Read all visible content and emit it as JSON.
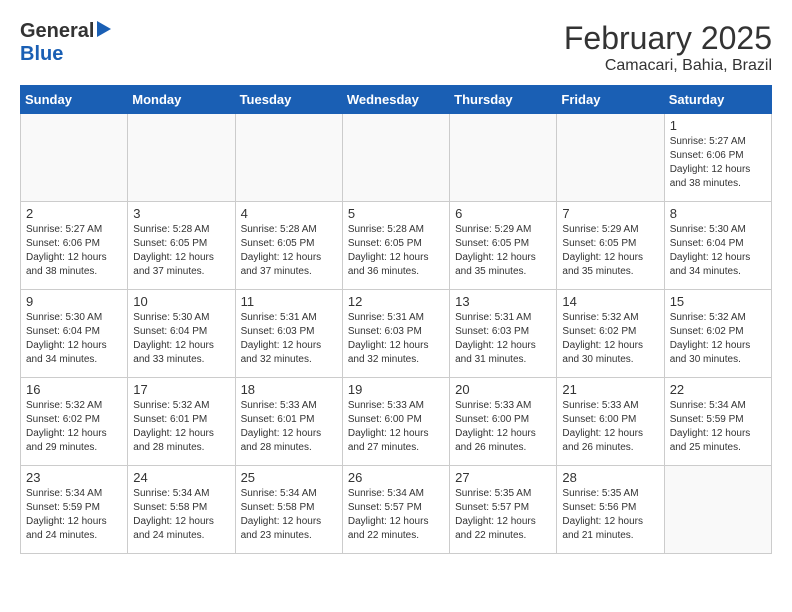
{
  "header": {
    "logo_general": "General",
    "logo_blue": "Blue",
    "title": "February 2025",
    "subtitle": "Camacari, Bahia, Brazil"
  },
  "days_of_week": [
    "Sunday",
    "Monday",
    "Tuesday",
    "Wednesday",
    "Thursday",
    "Friday",
    "Saturday"
  ],
  "weeks": [
    [
      {
        "day": "",
        "info": ""
      },
      {
        "day": "",
        "info": ""
      },
      {
        "day": "",
        "info": ""
      },
      {
        "day": "",
        "info": ""
      },
      {
        "day": "",
        "info": ""
      },
      {
        "day": "",
        "info": ""
      },
      {
        "day": "1",
        "info": "Sunrise: 5:27 AM\nSunset: 6:06 PM\nDaylight: 12 hours\nand 38 minutes."
      }
    ],
    [
      {
        "day": "2",
        "info": "Sunrise: 5:27 AM\nSunset: 6:06 PM\nDaylight: 12 hours\nand 38 minutes."
      },
      {
        "day": "3",
        "info": "Sunrise: 5:28 AM\nSunset: 6:05 PM\nDaylight: 12 hours\nand 37 minutes."
      },
      {
        "day": "4",
        "info": "Sunrise: 5:28 AM\nSunset: 6:05 PM\nDaylight: 12 hours\nand 37 minutes."
      },
      {
        "day": "5",
        "info": "Sunrise: 5:28 AM\nSunset: 6:05 PM\nDaylight: 12 hours\nand 36 minutes."
      },
      {
        "day": "6",
        "info": "Sunrise: 5:29 AM\nSunset: 6:05 PM\nDaylight: 12 hours\nand 35 minutes."
      },
      {
        "day": "7",
        "info": "Sunrise: 5:29 AM\nSunset: 6:05 PM\nDaylight: 12 hours\nand 35 minutes."
      },
      {
        "day": "8",
        "info": "Sunrise: 5:30 AM\nSunset: 6:04 PM\nDaylight: 12 hours\nand 34 minutes."
      }
    ],
    [
      {
        "day": "9",
        "info": "Sunrise: 5:30 AM\nSunset: 6:04 PM\nDaylight: 12 hours\nand 34 minutes."
      },
      {
        "day": "10",
        "info": "Sunrise: 5:30 AM\nSunset: 6:04 PM\nDaylight: 12 hours\nand 33 minutes."
      },
      {
        "day": "11",
        "info": "Sunrise: 5:31 AM\nSunset: 6:03 PM\nDaylight: 12 hours\nand 32 minutes."
      },
      {
        "day": "12",
        "info": "Sunrise: 5:31 AM\nSunset: 6:03 PM\nDaylight: 12 hours\nand 32 minutes."
      },
      {
        "day": "13",
        "info": "Sunrise: 5:31 AM\nSunset: 6:03 PM\nDaylight: 12 hours\nand 31 minutes."
      },
      {
        "day": "14",
        "info": "Sunrise: 5:32 AM\nSunset: 6:02 PM\nDaylight: 12 hours\nand 30 minutes."
      },
      {
        "day": "15",
        "info": "Sunrise: 5:32 AM\nSunset: 6:02 PM\nDaylight: 12 hours\nand 30 minutes."
      }
    ],
    [
      {
        "day": "16",
        "info": "Sunrise: 5:32 AM\nSunset: 6:02 PM\nDaylight: 12 hours\nand 29 minutes."
      },
      {
        "day": "17",
        "info": "Sunrise: 5:32 AM\nSunset: 6:01 PM\nDaylight: 12 hours\nand 28 minutes."
      },
      {
        "day": "18",
        "info": "Sunrise: 5:33 AM\nSunset: 6:01 PM\nDaylight: 12 hours\nand 28 minutes."
      },
      {
        "day": "19",
        "info": "Sunrise: 5:33 AM\nSunset: 6:00 PM\nDaylight: 12 hours\nand 27 minutes."
      },
      {
        "day": "20",
        "info": "Sunrise: 5:33 AM\nSunset: 6:00 PM\nDaylight: 12 hours\nand 26 minutes."
      },
      {
        "day": "21",
        "info": "Sunrise: 5:33 AM\nSunset: 6:00 PM\nDaylight: 12 hours\nand 26 minutes."
      },
      {
        "day": "22",
        "info": "Sunrise: 5:34 AM\nSunset: 5:59 PM\nDaylight: 12 hours\nand 25 minutes."
      }
    ],
    [
      {
        "day": "23",
        "info": "Sunrise: 5:34 AM\nSunset: 5:59 PM\nDaylight: 12 hours\nand 24 minutes."
      },
      {
        "day": "24",
        "info": "Sunrise: 5:34 AM\nSunset: 5:58 PM\nDaylight: 12 hours\nand 24 minutes."
      },
      {
        "day": "25",
        "info": "Sunrise: 5:34 AM\nSunset: 5:58 PM\nDaylight: 12 hours\nand 23 minutes."
      },
      {
        "day": "26",
        "info": "Sunrise: 5:34 AM\nSunset: 5:57 PM\nDaylight: 12 hours\nand 22 minutes."
      },
      {
        "day": "27",
        "info": "Sunrise: 5:35 AM\nSunset: 5:57 PM\nDaylight: 12 hours\nand 22 minutes."
      },
      {
        "day": "28",
        "info": "Sunrise: 5:35 AM\nSunset: 5:56 PM\nDaylight: 12 hours\nand 21 minutes."
      },
      {
        "day": "",
        "info": ""
      }
    ]
  ]
}
